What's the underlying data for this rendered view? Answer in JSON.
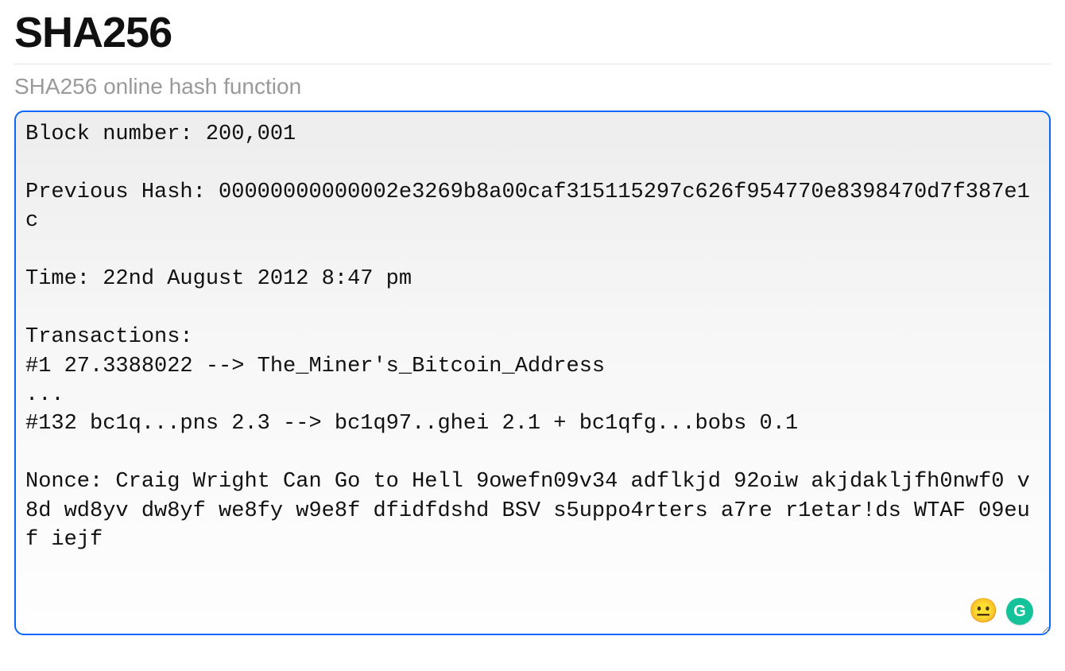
{
  "header": {
    "title": "SHA256",
    "subtitle": "SHA256 online hash function"
  },
  "input": {
    "value": "Block number: 200,001\n\nPrevious Hash: 00000000000002e3269b8a00caf315115297c626f954770e8398470d7f387e1c\n\nTime: 22nd August 2012 8:47 pm\n\nTransactions:\n#1 27.3388022 --> The_Miner's_Bitcoin_Address\n...\n#132 bc1q...pns 2.3 --> bc1q97..ghei 2.1 + bc1qfg...bobs 0.1\n\nNonce: Craig Wright Can Go to Hell 9owefn09v34 adflkjd 92oiw akjdakljfh0nwf0 v8d wd8yv dw8yf we8fy w9e8f dfidfdshd BSV s5uppo4rters a7re r1etar!ds WTAF 09euf iejf"
  },
  "icons": {
    "emoji": "😐",
    "grammarly_label": "G"
  }
}
